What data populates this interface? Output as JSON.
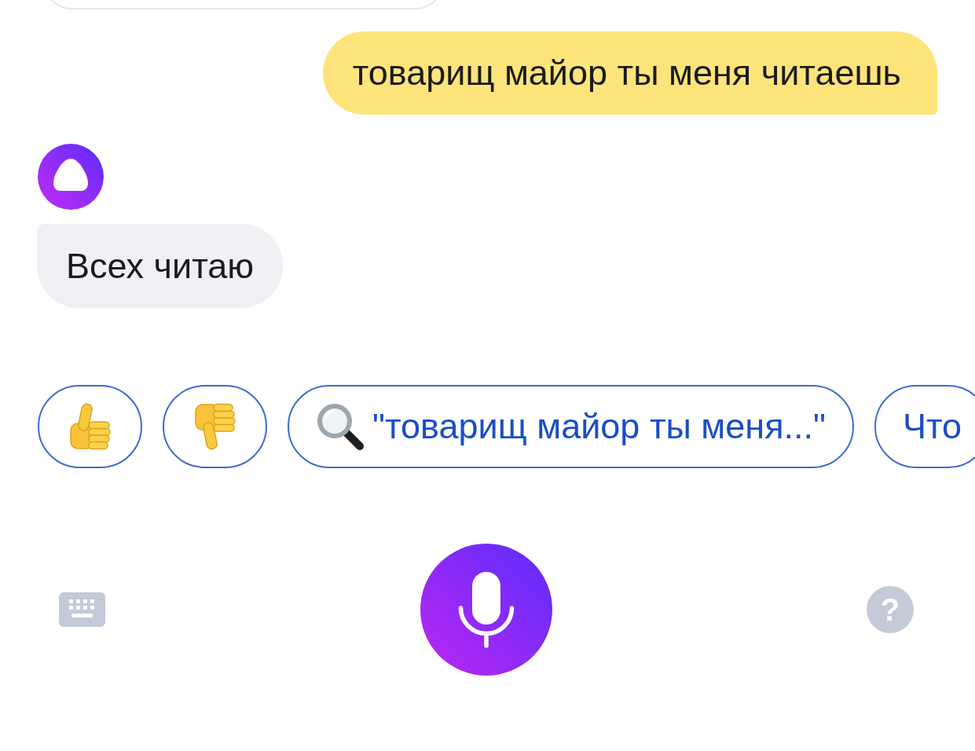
{
  "messages": [
    {
      "kind": "user",
      "text": "товарищ майор ты меня читаешь"
    },
    {
      "kind": "assistant",
      "text": "Всех читаю"
    }
  ],
  "suggestions": [
    {
      "kind": "like"
    },
    {
      "kind": "dislike"
    },
    {
      "kind": "search",
      "label": "\"товарищ майор ты меня...\""
    },
    {
      "kind": "text",
      "label": "Что"
    }
  ],
  "controls": {
    "help_label": "?"
  }
}
